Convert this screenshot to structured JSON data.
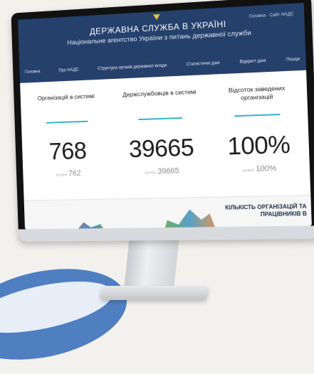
{
  "header": {
    "title": "ДЕРЖАВНА СЛУЖБА В УКРАЇНІ",
    "subtitle": "Національне агентство України з питань державної служби",
    "links": "Головна · Сайт НАДС"
  },
  "nav": {
    "items": [
      "Головна",
      "Про НАДС",
      "Структура органів державної влади",
      "Статистичні дані",
      "Відкриті дані",
      "Пошук"
    ]
  },
  "stats": [
    {
      "label": "Організацій в системі",
      "value": "768",
      "prev_prefix": "раніше",
      "prev": "762"
    },
    {
      "label": "Держслужбовців в системі",
      "value": "39665",
      "prev_prefix": "раніше",
      "prev": "39665"
    },
    {
      "label": "Відсоток заведених організацій",
      "value": "100%",
      "prev_prefix": "раніше",
      "prev": "100%"
    }
  ],
  "bottom": {
    "title": "КІЛЬКІСТЬ ОРГАНІЗАЦІЙ ТА ПРАЦІВНИКІВ В"
  },
  "colors": {
    "header_bg": "#25406b",
    "accent": "#34b4c7"
  }
}
